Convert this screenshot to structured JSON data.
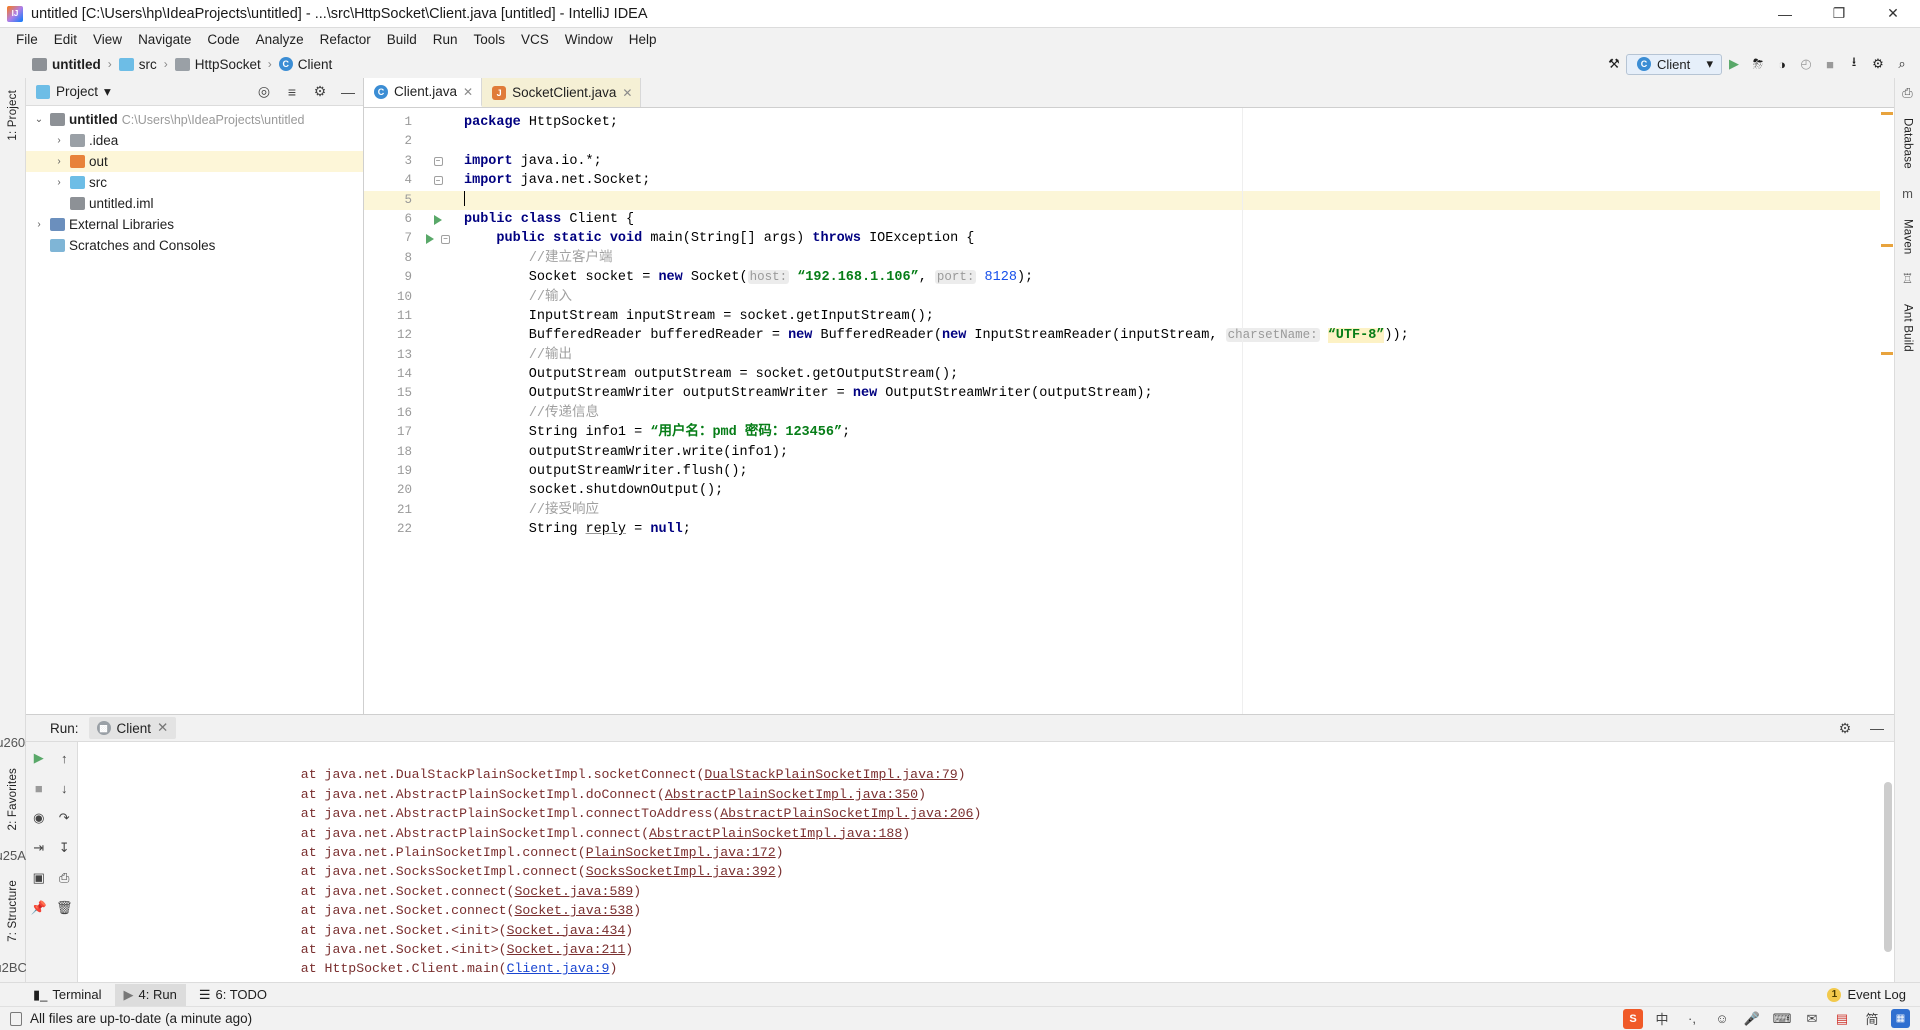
{
  "window": {
    "title": "untitled [C:\\Users\\hp\\IdeaProjects\\untitled] - ...\\src\\HttpSocket\\Client.java [untitled] - IntelliJ IDEA",
    "minimize": "—",
    "maximize": "❐",
    "close": "✕"
  },
  "menubar": {
    "items": [
      "File",
      "Edit",
      "View",
      "Navigate",
      "Code",
      "Analyze",
      "Refactor",
      "Build",
      "Run",
      "Tools",
      "VCS",
      "Window",
      "Help"
    ]
  },
  "navbar": {
    "crumbs": [
      "untitled",
      "src",
      "HttpSocket",
      "Client"
    ],
    "separator": "›",
    "run_configuration": "Client",
    "chevron": "▾",
    "icons": {
      "hammer": "⚒",
      "run": "▶",
      "debug": "⛈",
      "coverage": "◑",
      "profile": "◴",
      "stop": "■",
      "updates": "⭳",
      "settings": "⚙",
      "search": "⌕"
    }
  },
  "left_rail": {
    "tabs": [
      "1: Project",
      "2: Favorites",
      "7: Structure"
    ]
  },
  "right_rail": {
    "tabs": [
      "Database",
      "Maven",
      "Ant Build"
    ]
  },
  "project_panel": {
    "title": "Project",
    "dropdown": "▾",
    "header_icons": [
      "locate-icon",
      "collapse-icon",
      "settings-icon",
      "hide-icon"
    ],
    "tree": [
      {
        "label": "untitled",
        "path": "C:\\Users\\hp\\IdeaProjects\\untitled",
        "arrow": "⌄",
        "icon": "proj",
        "depth": 0,
        "bold": true,
        "selected": false
      },
      {
        "label": ".idea",
        "path": "",
        "arrow": "›",
        "icon": "grey",
        "depth": 1,
        "bold": false,
        "selected": false
      },
      {
        "label": "out",
        "path": "",
        "arrow": "›",
        "icon": "orange",
        "depth": 1,
        "bold": false,
        "selected": true
      },
      {
        "label": "src",
        "path": "",
        "arrow": "›",
        "icon": "blue",
        "depth": 1,
        "bold": false,
        "selected": false
      },
      {
        "label": "untitled.iml",
        "path": "",
        "arrow": "",
        "icon": "iml",
        "depth": 1,
        "bold": false,
        "selected": false
      },
      {
        "label": "External Libraries",
        "path": "",
        "arrow": "›",
        "icon": "lib",
        "depth": 0,
        "bold": false,
        "selected": false
      },
      {
        "label": "Scratches and Consoles",
        "path": "",
        "arrow": "",
        "icon": "lib",
        "depth": 0,
        "bold": false,
        "selected": false
      }
    ]
  },
  "editor": {
    "tabs": [
      {
        "label": "Client.java",
        "icon": "class-icon",
        "active": true,
        "close": "✕"
      },
      {
        "label": "SocketClient.java",
        "icon": "java-icon",
        "active": false,
        "close": "✕"
      }
    ],
    "lines": [
      {
        "n": 1,
        "current": false,
        "runmark": false,
        "fold": "",
        "html": "<span class=\"kw\">package</span> HttpSocket;"
      },
      {
        "n": 2,
        "current": false,
        "runmark": false,
        "fold": "",
        "html": ""
      },
      {
        "n": 3,
        "current": false,
        "runmark": false,
        "fold": "-",
        "html": "<span class=\"kw\">import</span> java.io.*;"
      },
      {
        "n": 4,
        "current": false,
        "runmark": false,
        "fold": "-",
        "html": "<span class=\"kw\">import</span> java.net.Socket;"
      },
      {
        "n": 5,
        "current": true,
        "runmark": false,
        "fold": "",
        "html": "<span class=\"caret\"></span>"
      },
      {
        "n": 6,
        "current": false,
        "runmark": true,
        "fold": "",
        "html": "<span class=\"kw\">public class</span> Client {"
      },
      {
        "n": 7,
        "current": false,
        "runmark": true,
        "fold": "-",
        "html": "    <span class=\"kw\">public static void</span> main(String[] args) <span class=\"kw\">throws</span> IOException {"
      },
      {
        "n": 8,
        "current": false,
        "runmark": false,
        "fold": "",
        "html": "        <span class=\"cmt\">//建立客户端</span>"
      },
      {
        "n": 9,
        "current": false,
        "runmark": false,
        "fold": "",
        "html": "        Socket socket = <span class=\"kw\">new</span> Socket(<span class=\"hint\">host:</span> <span class=\"str\">“192.168.1.106”</span>, <span class=\"hint\">port:</span> <span class=\"num\">8128</span>);"
      },
      {
        "n": 10,
        "current": false,
        "runmark": false,
        "fold": "",
        "html": "        <span class=\"cmt\">//输入</span>"
      },
      {
        "n": 11,
        "current": false,
        "runmark": false,
        "fold": "",
        "html": "        InputStream inputStream = socket.getInputStream();"
      },
      {
        "n": 12,
        "current": false,
        "runmark": false,
        "fold": "",
        "html": "        BufferedReader bufferedReader = <span class=\"kw\">new</span> BufferedReader(<span class=\"kw\">new</span> InputStreamReader(inputStream, <span class=\"hint\">charsetName:</span> <span class=\"str strhl\">“UTF-8”</span>));"
      },
      {
        "n": 13,
        "current": false,
        "runmark": false,
        "fold": "",
        "html": "        <span class=\"cmt\">//输出</span>"
      },
      {
        "n": 14,
        "current": false,
        "runmark": false,
        "fold": "",
        "html": "        OutputStream outputStream = socket.getOutputStream();"
      },
      {
        "n": 15,
        "current": false,
        "runmark": false,
        "fold": "",
        "html": "        OutputStreamWriter outputStreamWriter = <span class=\"kw\">new</span> OutputStreamWriter(outputStream);"
      },
      {
        "n": 16,
        "current": false,
        "runmark": false,
        "fold": "",
        "html": "        <span class=\"cmt\">//传递信息</span>"
      },
      {
        "n": 17,
        "current": false,
        "runmark": false,
        "fold": "",
        "html": "        String info1 = <span class=\"str\">“用户名：pmd 密码：123456”</span>;"
      },
      {
        "n": 18,
        "current": false,
        "runmark": false,
        "fold": "",
        "html": "        outputStreamWriter.write(info1);"
      },
      {
        "n": 19,
        "current": false,
        "runmark": false,
        "fold": "",
        "html": "        outputStreamWriter.flush();"
      },
      {
        "n": 20,
        "current": false,
        "runmark": false,
        "fold": "",
        "html": "        socket.shutdownOutput();"
      },
      {
        "n": 21,
        "current": false,
        "runmark": false,
        "fold": "",
        "html": "        <span class=\"cmt\">//接受响应</span>"
      },
      {
        "n": 22,
        "current": false,
        "runmark": false,
        "fold": "",
        "html": "        String <span class=\"idu\">reply</span> = <span class=\"kw\">null</span>;"
      }
    ]
  },
  "run_panel": {
    "label": "Run:",
    "tab": "Client",
    "tab_close": "✕",
    "settings_icon": "⚙",
    "hide_icon": "—",
    "toolbar_icons": [
      "run-icon",
      "stop-icon",
      "camera-icon",
      "export-icon",
      "up-icon",
      "down-icon",
      "wrap-icon",
      "scroll-icon",
      "print-icon",
      "trash-icon",
      "pin-icon"
    ],
    "console_lines": [
      {
        "text": "at java.net.DualStackPlainSocketImpl.socketConnect(",
        "link": "DualStackPlainSocketImpl.java:79",
        "tail": ")",
        "blue": false
      },
      {
        "text": "at java.net.AbstractPlainSocketImpl.doConnect(",
        "link": "AbstractPlainSocketImpl.java:350",
        "tail": ")",
        "blue": false
      },
      {
        "text": "at java.net.AbstractPlainSocketImpl.connectToAddress(",
        "link": "AbstractPlainSocketImpl.java:206",
        "tail": ")",
        "blue": false
      },
      {
        "text": "at java.net.AbstractPlainSocketImpl.connect(",
        "link": "AbstractPlainSocketImpl.java:188",
        "tail": ")",
        "blue": false
      },
      {
        "text": "at java.net.PlainSocketImpl.connect(",
        "link": "PlainSocketImpl.java:172",
        "tail": ")",
        "blue": false
      },
      {
        "text": "at java.net.SocksSocketImpl.connect(",
        "link": "SocksSocketImpl.java:392",
        "tail": ")",
        "blue": false
      },
      {
        "text": "at java.net.Socket.connect(",
        "link": "Socket.java:589",
        "tail": ")",
        "blue": false
      },
      {
        "text": "at java.net.Socket.connect(",
        "link": "Socket.java:538",
        "tail": ")",
        "blue": false
      },
      {
        "text": "at java.net.Socket.<init>(",
        "link": "Socket.java:434",
        "tail": ")",
        "blue": false
      },
      {
        "text": "at java.net.Socket.<init>(",
        "link": "Socket.java:211",
        "tail": ")",
        "blue": false
      },
      {
        "text": "at HttpSocket.Client.main(",
        "link": "Client.java:9",
        "tail": ")",
        "blue": true
      }
    ]
  },
  "bottom_tabs": {
    "items": [
      {
        "label": "Terminal",
        "icon": "terminal-icon",
        "active": false
      },
      {
        "label": "4: Run",
        "icon": "run-icon",
        "active": true
      },
      {
        "label": "6: TODO",
        "icon": "todo-icon",
        "active": false
      }
    ],
    "event_log": "Event Log",
    "event_count": "1"
  },
  "statusbar": {
    "message": "All files are up-to-date (a minute ago)",
    "tray": [
      "sogou-icon",
      "中",
      "·,",
      "☺",
      "🎤",
      "⌨",
      "✉",
      "▤",
      "简",
      "▒"
    ]
  },
  "colors": {
    "accent": "#3b8dd4",
    "selection": "#fdf6d8",
    "keyword": "#000080",
    "string": "#067d17",
    "comment": "#a0a0a0",
    "error": "#7a2f2f",
    "link": "#1a46d1"
  }
}
